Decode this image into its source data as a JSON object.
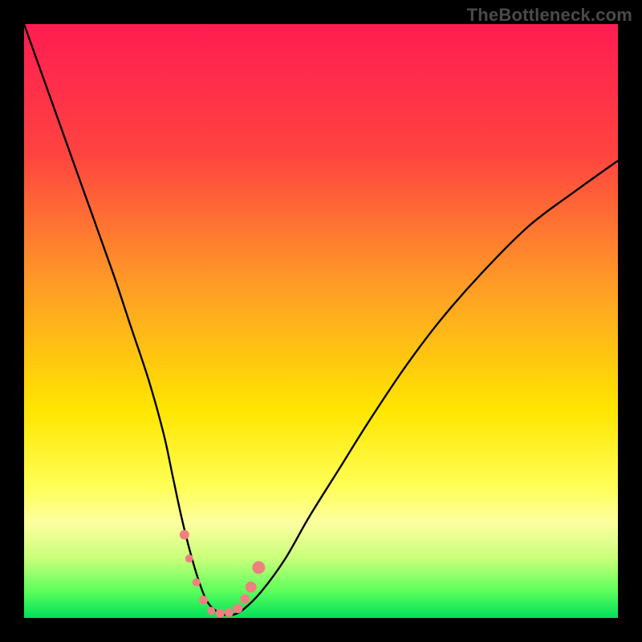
{
  "watermark": "TheBottleneck.com",
  "chart_data": {
    "type": "line",
    "title": "",
    "xlabel": "",
    "ylabel": "",
    "xlim": [
      0,
      100
    ],
    "ylim": [
      0,
      100
    ],
    "gradient_stops": [
      {
        "offset": 0,
        "color": "#ff1c52"
      },
      {
        "offset": 0.22,
        "color": "#ff4440"
      },
      {
        "offset": 0.45,
        "color": "#ffa024"
      },
      {
        "offset": 0.65,
        "color": "#ffe600"
      },
      {
        "offset": 0.78,
        "color": "#ffff58"
      },
      {
        "offset": 0.84,
        "color": "#fdffa0"
      },
      {
        "offset": 0.9,
        "color": "#c8ff7a"
      },
      {
        "offset": 0.955,
        "color": "#5cff5c"
      },
      {
        "offset": 1.0,
        "color": "#00e05a"
      }
    ],
    "series": [
      {
        "name": "bottleneck-curve",
        "x": [
          0,
          5,
          10,
          15,
          18,
          21,
          23.5,
          25,
          26.5,
          28,
          29.5,
          31,
          33,
          35,
          37,
          40,
          44,
          48,
          53,
          58,
          64,
          70,
          77,
          85,
          93,
          100
        ],
        "values": [
          100,
          86,
          72,
          58,
          49,
          40,
          31,
          24,
          17,
          11,
          6,
          2.5,
          0.8,
          0.5,
          1.5,
          4.5,
          10,
          17,
          25,
          33,
          42,
          50,
          58,
          66,
          72,
          77
        ]
      }
    ],
    "markers": {
      "name": "highlight-points",
      "color": "#f08080",
      "x": [
        27,
        27.8,
        29,
        30.2,
        31.5,
        33,
        34.5,
        36,
        37.2,
        38.2,
        39.5
      ],
      "values": [
        14,
        10,
        6,
        3,
        1.2,
        0.8,
        0.9,
        1.6,
        3.2,
        5.2,
        8.5
      ],
      "r": [
        6,
        5,
        5,
        5.5,
        5,
        5.5,
        5.5,
        6,
        6,
        7,
        8
      ]
    }
  }
}
